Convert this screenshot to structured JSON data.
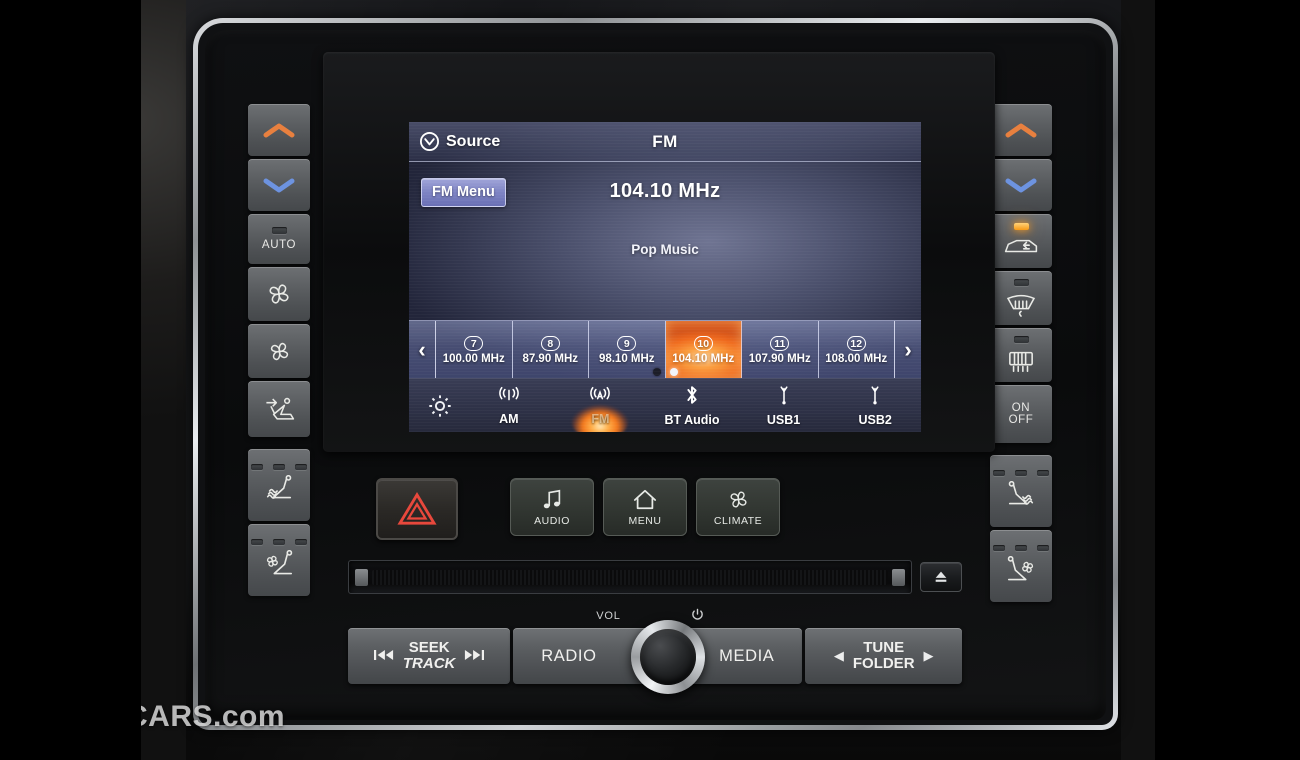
{
  "screen": {
    "header": {
      "source_label": "Source",
      "source_icon": "chevron-down-circle-icon",
      "title": "FM"
    },
    "fm_menu_label": "FM Menu",
    "frequency": "104.10 MHz",
    "genre": "Pop Music",
    "presets": {
      "prev_arrow": "‹",
      "next_arrow": "›",
      "items": [
        {
          "num": "7",
          "freq": "100.00 MHz",
          "active": false
        },
        {
          "num": "8",
          "freq": "87.90 MHz",
          "active": false
        },
        {
          "num": "9",
          "freq": "98.10 MHz",
          "active": false
        },
        {
          "num": "10",
          "freq": "104.10 MHz",
          "active": true
        },
        {
          "num": "11",
          "freq": "107.90 MHz",
          "active": false
        },
        {
          "num": "12",
          "freq": "108.00 MHz",
          "active": false
        }
      ],
      "pages": {
        "count": 2,
        "active_index": 1
      }
    },
    "source_bar": {
      "settings_icon": "gear-icon",
      "items": [
        {
          "label": "AM",
          "icon": "am-antenna-icon",
          "active": false
        },
        {
          "label": "FM",
          "icon": "fm-antenna-icon",
          "active": true
        },
        {
          "label": "BT Audio",
          "icon": "bluetooth-icon",
          "active": false
        },
        {
          "label": "USB1",
          "icon": "usb-icon",
          "active": false
        },
        {
          "label": "USB2",
          "icon": "usb-icon",
          "active": false
        }
      ]
    }
  },
  "left_panel": {
    "buttons": [
      {
        "name": "temp-up",
        "icon": "chevron-up-icon",
        "label": "",
        "leds": 0
      },
      {
        "name": "temp-down",
        "icon": "chevron-down-icon",
        "label": "",
        "leds": 0
      },
      {
        "name": "auto",
        "icon": "",
        "label": "AUTO",
        "leds": 1,
        "led_on": false
      },
      {
        "name": "fan-up",
        "icon": "fan-icon",
        "label": "",
        "leds": 0
      },
      {
        "name": "fan-down",
        "icon": "fan-icon",
        "label": "",
        "leds": 0
      },
      {
        "name": "airflow-mode",
        "icon": "airflow-seat-icon",
        "label": "",
        "leds": 0
      },
      {
        "name": "seat-heater",
        "icon": "heated-seat-icon",
        "label": "",
        "leds": 3
      },
      {
        "name": "seat-ventilate",
        "icon": "ventilated-seat-icon",
        "label": "",
        "leds": 3
      }
    ]
  },
  "right_panel": {
    "buttons": [
      {
        "name": "temp-up",
        "icon": "chevron-up-icon",
        "label": "",
        "leds": 0
      },
      {
        "name": "temp-down",
        "icon": "chevron-down-icon",
        "label": "",
        "leds": 0
      },
      {
        "name": "recirculation",
        "icon": "recirculation-icon",
        "label": "",
        "leds": 1,
        "led_on": true
      },
      {
        "name": "front-defrost",
        "icon": "front-defrost-icon",
        "label": "",
        "leds": 1,
        "led_on": false
      },
      {
        "name": "rear-defrost",
        "icon": "rear-defrost-icon",
        "label": "",
        "leds": 1,
        "led_on": false
      },
      {
        "name": "power-on-off",
        "icon": "",
        "label": "ON\nOFF",
        "leds": 0
      },
      {
        "name": "seat-heater",
        "icon": "heated-seat-icon",
        "label": "",
        "leds": 3
      },
      {
        "name": "seat-ventilate",
        "icon": "ventilated-seat-icon",
        "label": "",
        "leds": 3
      }
    ],
    "power_line1": "ON",
    "power_line2": "OFF"
  },
  "center_buttons": {
    "hazard": {
      "label": "",
      "icon": "hazard-triangle-icon",
      "color": "#e8483c"
    },
    "items": [
      {
        "label": "AUDIO",
        "icon": "music-note-icon"
      },
      {
        "label": "MENU",
        "icon": "home-icon"
      },
      {
        "label": "CLIMATE",
        "icon": "fan-icon"
      }
    ]
  },
  "media_deck": {
    "eject_icon": "eject-icon",
    "vol_label": "VOL",
    "power_icon": "power-icon",
    "buttons": {
      "seek_line1": "SEEK",
      "seek_line2": "TRACK",
      "seek_prev_icon": "skip-previous-icon",
      "seek_next_icon": "skip-next-icon",
      "radio": "RADIO",
      "media": "MEDIA",
      "tune_line1": "TUNE",
      "tune_line2": "FOLDER",
      "tune_prev_icon": "triangle-left-icon",
      "tune_next_icon": "triangle-right-icon"
    }
  },
  "watermark": {
    "text": "CARS.com"
  },
  "colors": {
    "accent_orange": "#f4781d",
    "accent_blue": "#6d93e0",
    "hazard_red": "#e8483c",
    "screen_blue": "#4a4f6b"
  }
}
